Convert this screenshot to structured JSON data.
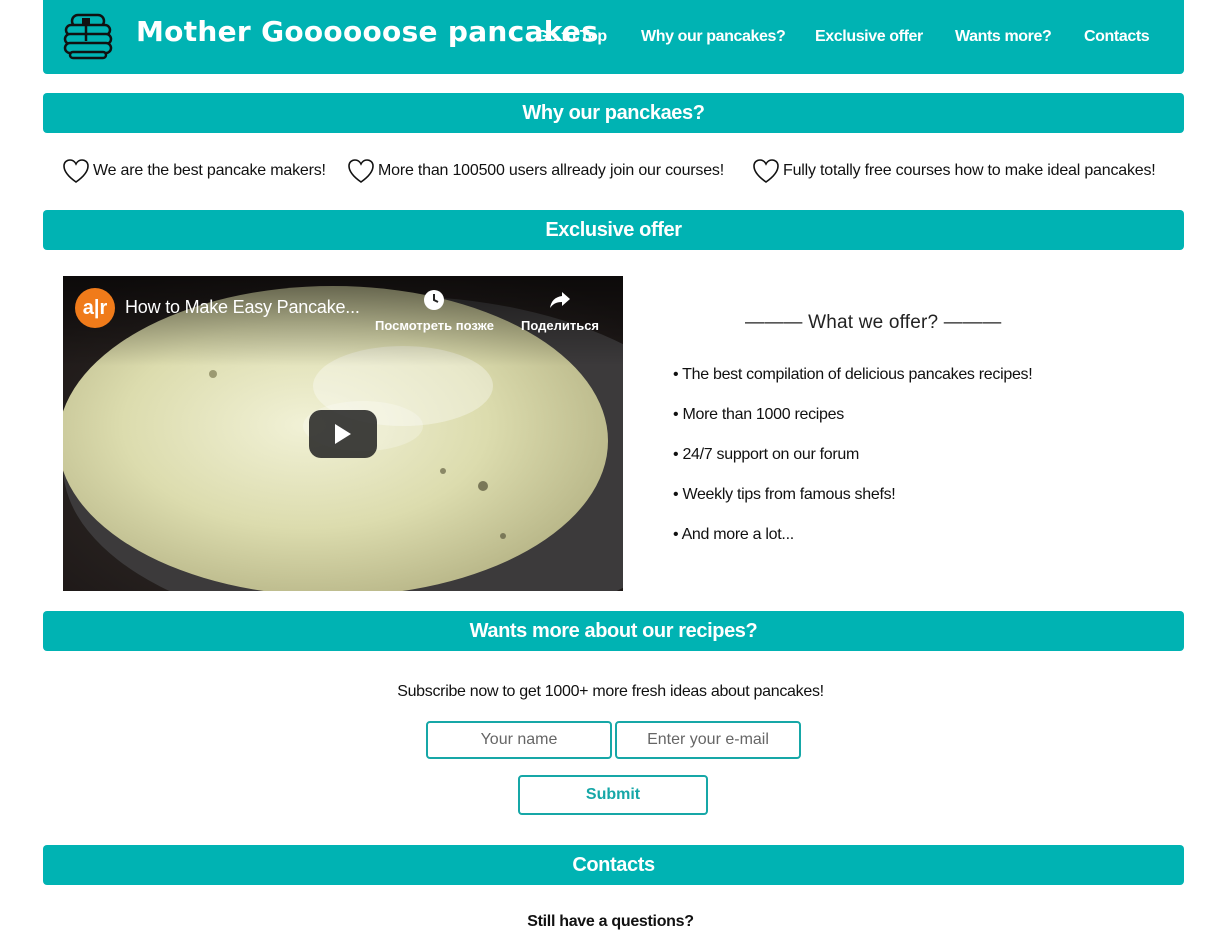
{
  "header": {
    "brand": "Mother Goooooose pancakes",
    "logo_icon": "pancake-stack-icon",
    "nav": [
      "Go to Top",
      "Why our pancakes?",
      "Exclusive offer",
      "Wants more?",
      "Contacts"
    ]
  },
  "why": {
    "heading": "Why our panckaes?",
    "benefit_icon": "heart-icon",
    "items": [
      "We are the best pancake makers!",
      "More than 100500 users allready join our courses!",
      "Fully totally free courses how to make ideal pancakes!"
    ]
  },
  "offer": {
    "heading": "Exclusive offer",
    "video": {
      "channel_logo_text": "a|r",
      "title": "How to Make Easy Pancake...",
      "watch_later": "Посмотреть позже",
      "share": "Поделиться"
    },
    "subtitle": "——— What we offer? ———",
    "items": [
      "• The best compilation of delicious pancakes recipes!",
      "• More than 1000 recipes",
      "• 24/7 support on our forum",
      "• Weekly tips from famous shefs!",
      "• And more a lot..."
    ]
  },
  "subscribe": {
    "heading": "Wants more about our recipes?",
    "text": "Subscribe now to get 1000+ more fresh ideas about pancakes!",
    "name_placeholder": "Your name",
    "email_placeholder": "Enter your e-mail",
    "submit": "Submit"
  },
  "contacts": {
    "heading": "Contacts",
    "text": "Still have a questions?"
  },
  "colors": {
    "accent": "#00b3b3",
    "border": "#16a7a7"
  }
}
